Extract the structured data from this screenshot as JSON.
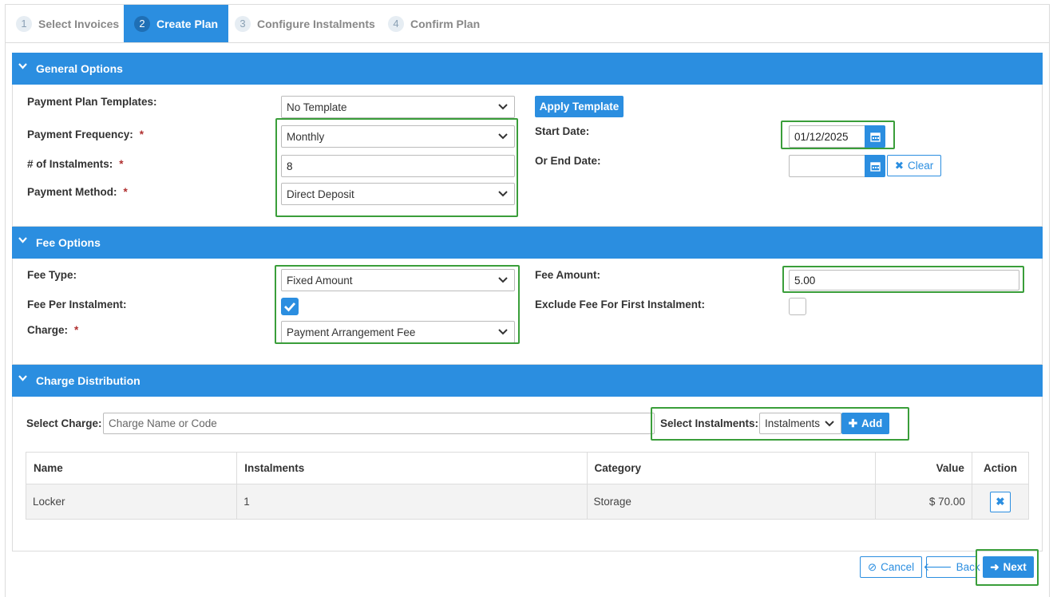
{
  "wizard": {
    "steps": [
      {
        "num": "1",
        "label": "Select Invoices"
      },
      {
        "num": "2",
        "label": "Create Plan"
      },
      {
        "num": "3",
        "label": "Configure Instalments"
      },
      {
        "num": "4",
        "label": "Confirm Plan"
      }
    ],
    "active_step": 2
  },
  "general": {
    "title": "General Options",
    "templates_label": "Payment Plan Templates:",
    "templates_value": "No Template",
    "apply_template": "Apply Template",
    "frequency_label": "Payment Frequency:",
    "frequency_value": "Monthly",
    "instalments_label": "# of Instalments:",
    "instalments_value": "8",
    "method_label": "Payment Method:",
    "method_value": "Direct Deposit",
    "start_label": "Start Date:",
    "start_value": "01/12/2025",
    "end_label": "Or End Date:",
    "end_value": "",
    "clear": "Clear",
    "required": "*"
  },
  "fees": {
    "title": "Fee Options",
    "type_label": "Fee Type:",
    "type_value": "Fixed Amount",
    "per_label": "Fee Per Instalment:",
    "per_checked": true,
    "charge_label": "Charge:",
    "charge_value": "Payment Arrangement Fee",
    "amount_label": "Fee Amount:",
    "amount_value": "5.00",
    "exclude_label": "Exclude Fee For First Instalment:",
    "exclude_checked": false
  },
  "distribution": {
    "title": "Charge Distribution",
    "select_charge_label": "Select Charge:",
    "charge_placeholder": "Charge Name or Code",
    "select_instalments_label": "Select Instalments:",
    "instalments_select": "Instalments",
    "add": "Add",
    "columns": [
      "Name",
      "Instalments",
      "Category",
      "Value",
      "Action"
    ],
    "rows": [
      {
        "name": "Locker",
        "instalments": "1",
        "category": "Storage",
        "value": "$ 70.00"
      }
    ]
  },
  "footer": {
    "cancel": "Cancel",
    "back": "Back",
    "next": "Next"
  },
  "colors": {
    "primary": "#2b8ee0",
    "highlight": "#3a9e3a",
    "required": "#b03030"
  }
}
